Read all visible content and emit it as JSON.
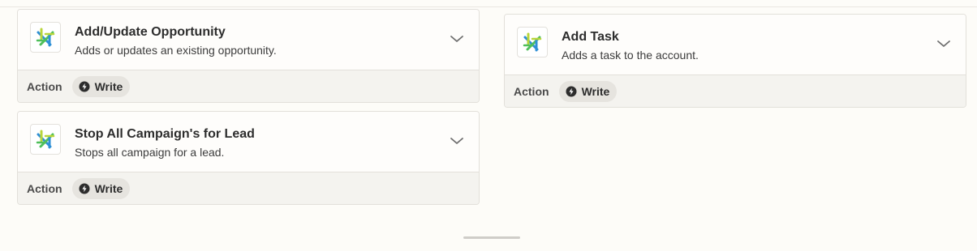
{
  "cards": [
    {
      "title": "Add/Update Opportunity",
      "description": "Adds or updates an existing opportunity.",
      "footer_label": "Action",
      "badge_label": "Write",
      "app_icon": "app-logo-icon",
      "badge_icon": "lightning-circle-icon",
      "toggle_icon": "chevron-down-icon"
    },
    {
      "title": "Stop All Campaign's for Lead",
      "description": "Stops all campaign for a lead.",
      "footer_label": "Action",
      "badge_label": "Write",
      "app_icon": "app-logo-icon",
      "badge_icon": "lightning-circle-icon",
      "toggle_icon": "chevron-down-icon"
    },
    {
      "title": "Add Task",
      "description": "Adds a task to the account.",
      "footer_label": "Action",
      "badge_label": "Write",
      "app_icon": "app-logo-icon",
      "badge_icon": "lightning-circle-icon",
      "toggle_icon": "chevron-down-icon"
    }
  ],
  "colors": {
    "page_background": "#fdfcf8",
    "card_footer": "#f4f3ef",
    "badge_background": "#e6e4df",
    "logo_blue": "#2e8fd6",
    "logo_green": "#4fbf5a",
    "logo_lime": "#b8d53a"
  }
}
